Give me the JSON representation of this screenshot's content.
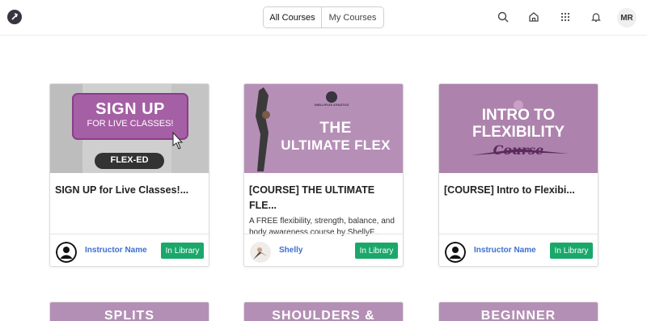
{
  "header": {
    "tabs": [
      {
        "label": "All Courses"
      },
      {
        "label": "My Courses"
      }
    ],
    "icons": [
      "search-icon",
      "home-icon",
      "apps-grid-icon",
      "bell-icon"
    ],
    "avatar_initials": "MR"
  },
  "colors": {
    "accent_green": "#1aa86a",
    "link_blue": "#3b6fd1",
    "brand_purple": "#b48fb5"
  },
  "courses": [
    {
      "title": "SIGN UP for Live Classes!...",
      "description": "",
      "instructor": "Instructor Name",
      "status": "In Library",
      "thumb": {
        "line1": "SIGN UP",
        "line2": "FOR LIVE CLASSES!",
        "badge": "FLEX-ED"
      }
    },
    {
      "title": "[COURSE] THE ULTIMATE FLE...",
      "description": "A FREE flexibility, strength, balance, and body awareness course by ShellyF...",
      "instructor": "Shelly",
      "status": "In Library",
      "thumb": {
        "line1": "THE",
        "line2": "ULTIMATE FLEX",
        "brand": "SHELLYFLEX ATHLETICS"
      }
    },
    {
      "title": "[COURSE] Intro to Flexibi...",
      "description": "",
      "instructor": "Instructor Name",
      "status": "In Library",
      "thumb": {
        "line1": "INTRO TO",
        "line2": "FLEXIBILITY",
        "line3": "Course"
      }
    }
  ],
  "bottom_cards": [
    {
      "text": "SPLITS"
    },
    {
      "text": "SHOULDERS &"
    },
    {
      "text": "BEGINNER"
    }
  ]
}
